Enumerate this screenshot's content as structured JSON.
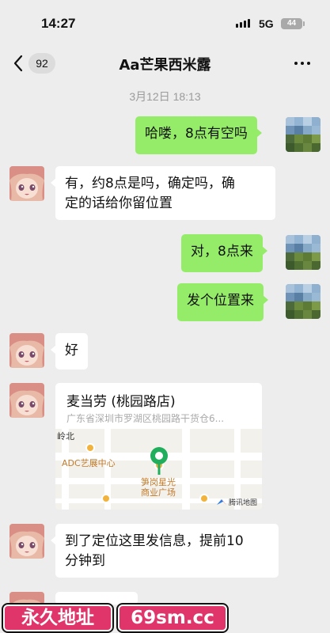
{
  "status": {
    "time": "14:27",
    "network": "5G",
    "battery": "44"
  },
  "nav": {
    "unread_count": "92",
    "title": "Aa芒果西米露"
  },
  "chat": {
    "timestamp": "3月12日 18:13",
    "messages": [
      {
        "side": "out",
        "text": "哈喽，8点有空吗"
      },
      {
        "side": "in",
        "text_line1": "有，约8点是吗，确定吗，确",
        "text_line2": "定的话给你留位置"
      },
      {
        "side": "out",
        "text": "对，8点来"
      },
      {
        "side": "out",
        "text": "发个位置来"
      },
      {
        "side": "in",
        "text": "好"
      },
      {
        "side": "in",
        "type": "location"
      },
      {
        "side": "in",
        "text_line1": "到了定位这里发信息，提前10",
        "text_line2": "分钟到"
      }
    ],
    "location": {
      "name": "麦当劳 (桃园路店)",
      "address": "广东省深圳市罗湖区桃园路干货仓6...",
      "map_labels": {
        "north": "岭北",
        "poi1": "ADC艺展中心",
        "poi2_line1": "笋岗星光",
        "poi2_line2": "商业广场",
        "provider": "腾讯地图"
      }
    }
  },
  "banners": {
    "left": "永久地址",
    "right": "69sm.cc"
  },
  "colors": {
    "background": "#ededed",
    "outgoing": "#95ec69",
    "incoming": "#ffffff",
    "banner": "#e0356a",
    "pin": "#1fae5b"
  }
}
